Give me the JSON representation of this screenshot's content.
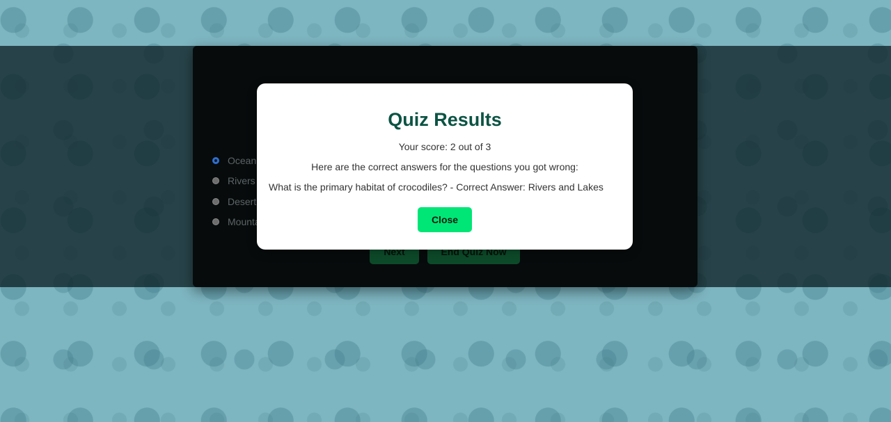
{
  "quiz": {
    "options": [
      "Ocean",
      "Rivers",
      "Desert",
      "Mounta"
    ],
    "selected_index": 0,
    "next_label": "Next",
    "end_label": "End Quiz Now"
  },
  "modal": {
    "title": "Quiz Results",
    "score_text": "Your score: 2 out of 3",
    "intro_text": "Here are the correct answers for the questions you got wrong:",
    "wrong_answers": [
      "What is the primary habitat of crocodiles? - Correct Answer: Rivers and Lakes"
    ],
    "close_label": "Close"
  },
  "colors": {
    "background": "#7db5c0",
    "accent": "#00e676",
    "title": "#0b5343"
  }
}
